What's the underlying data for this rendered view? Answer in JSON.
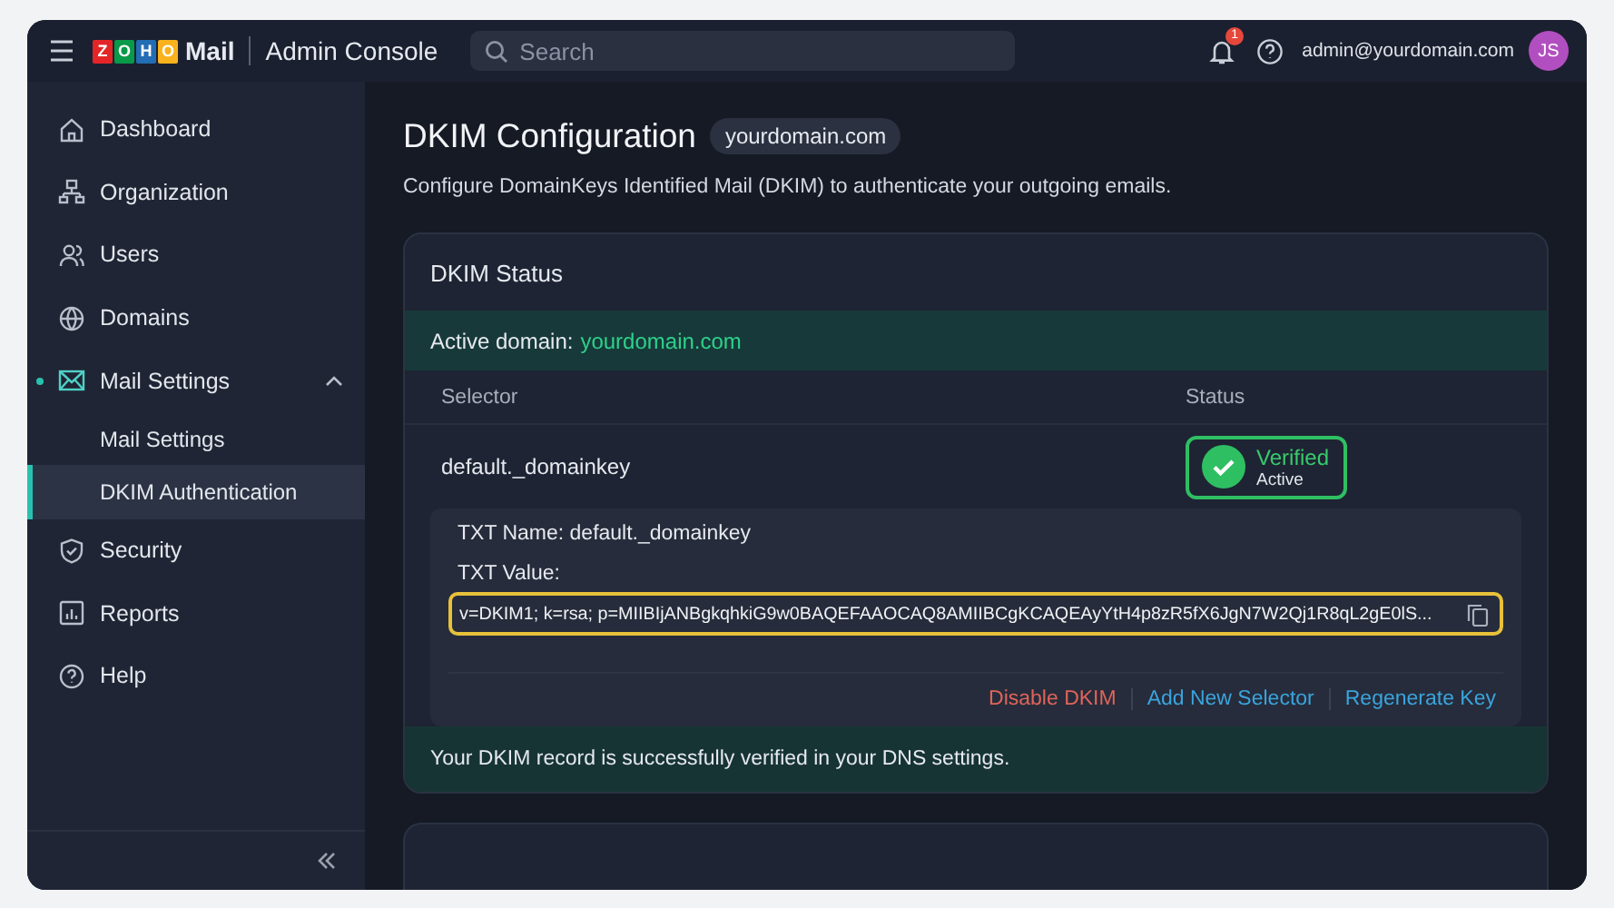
{
  "app": {
    "logo_letters": [
      {
        "letter": "Z",
        "color": "#e42527"
      },
      {
        "letter": "O",
        "color": "#089949"
      },
      {
        "letter": "H",
        "color": "#226db4"
      },
      {
        "letter": "O",
        "color": "#f9b21d"
      }
    ],
    "product": "Mail",
    "console": "Admin Console"
  },
  "search": {
    "placeholder": "Search"
  },
  "notifications": {
    "badge": "1"
  },
  "user": {
    "email": "admin@yourdomain.com",
    "initials": "JS"
  },
  "sidebar": {
    "items": [
      {
        "label": "Dashboard",
        "kind": "home",
        "selected": false
      },
      {
        "label": "Organization",
        "kind": "org",
        "selected": false
      },
      {
        "label": "Users",
        "kind": "users",
        "selected": false
      },
      {
        "label": "Domains",
        "kind": "globe",
        "selected": false
      },
      {
        "label": "Mail Settings",
        "kind": "mail",
        "selected": false,
        "expanded": true,
        "children": [
          {
            "label": "Mail Settings",
            "selected": false
          },
          {
            "label": "DKIM Authentication",
            "selected": true
          }
        ]
      },
      {
        "label": "Security",
        "kind": "shield",
        "selected": false
      },
      {
        "label": "Reports",
        "kind": "chart",
        "selected": false
      },
      {
        "label": "Help",
        "kind": "help",
        "selected": false
      }
    ]
  },
  "page": {
    "title": "DKIM Configuration",
    "domain_badge": "yourdomain.com",
    "description": "Configure DomainKeys Identified Mail (DKIM) to authenticate your outgoing emails."
  },
  "card": {
    "title": "DKIM Status",
    "active_domain_label": "Active domain:",
    "active_domain": "yourdomain.com",
    "columns": [
      "Selector",
      "Status"
    ],
    "rows": [
      {
        "selector": "default._domainkey",
        "status": "Verified",
        "substatus": "Active",
        "verified": true
      }
    ],
    "details": {
      "txt_name": "TXT Name: default._domainkey",
      "txt_value_label": "TXT Value:",
      "txt_value": "v=DKIM1; k=rsa; p=MIIBIjANBgkqhkiG9w0BAQEFAAOCAQ8AMIIBCgKCAQEAyYtH4p8zR5fX6JgN7W2Qj1R8qL2gE0lS...",
      "actions": [
        {
          "label": "Disable DKIM",
          "kind": "danger"
        },
        {
          "label": "Add New Selector",
          "kind": "link"
        },
        {
          "label": "Regenerate Key",
          "kind": "link"
        }
      ]
    },
    "footer": "Your DKIM record is successfully verified in your DNS settings."
  }
}
